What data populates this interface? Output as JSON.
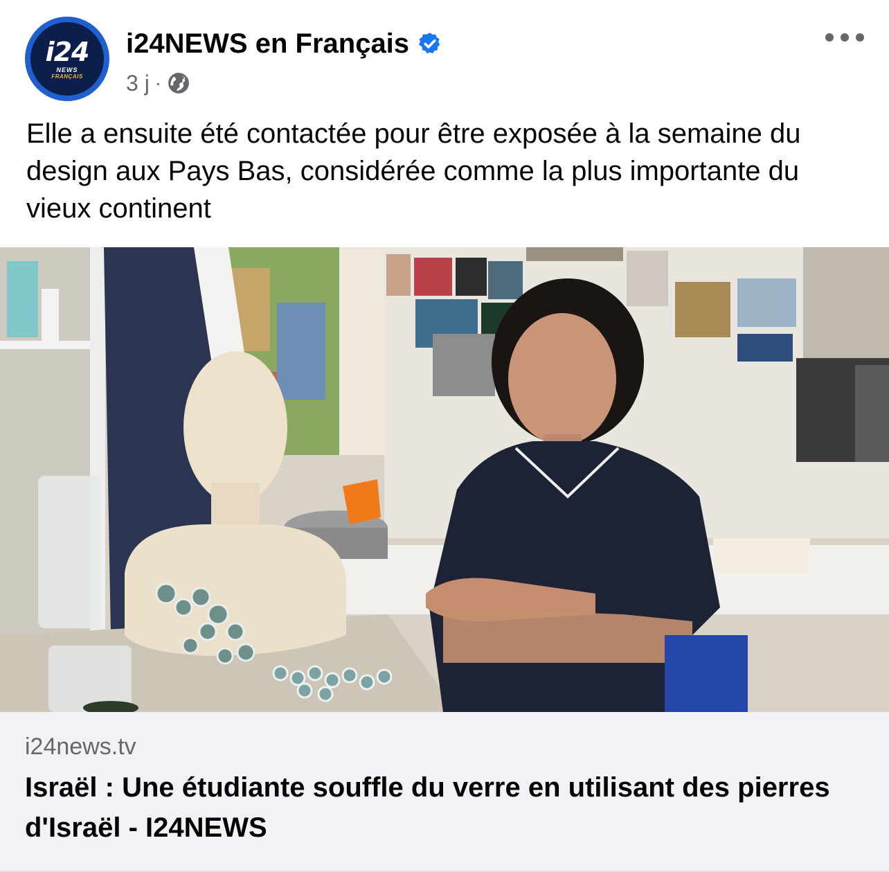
{
  "post": {
    "page_name": "i24NEWS en Français",
    "avatar": {
      "logo_main": "i24",
      "logo_sub1": "NEWS",
      "logo_sub2": "FRANÇAIS"
    },
    "time": "3 j",
    "separator": "·",
    "audience_icon": "globe-icon",
    "verified_icon": "verified-badge-icon",
    "more_icon": "more-options-icon",
    "text": "Elle a ensuite été contactée pour être exposée à la semaine du design aux Pays Bas, considérée comme la plus importante du vieux continent"
  },
  "link_preview": {
    "domain": "i24news.tv",
    "title": "Israël : Une étudiante souffle du verre en utilisant des pierres d'Israël - I24NEWS"
  },
  "colors": {
    "verified_blue": "#1877f2",
    "secondary_text": "#65676b",
    "card_background": "#f0f2f5",
    "avatar_ring": "#1f5fd0",
    "avatar_fill": "#0c1f4a",
    "logo_accent": "#f2b233"
  }
}
